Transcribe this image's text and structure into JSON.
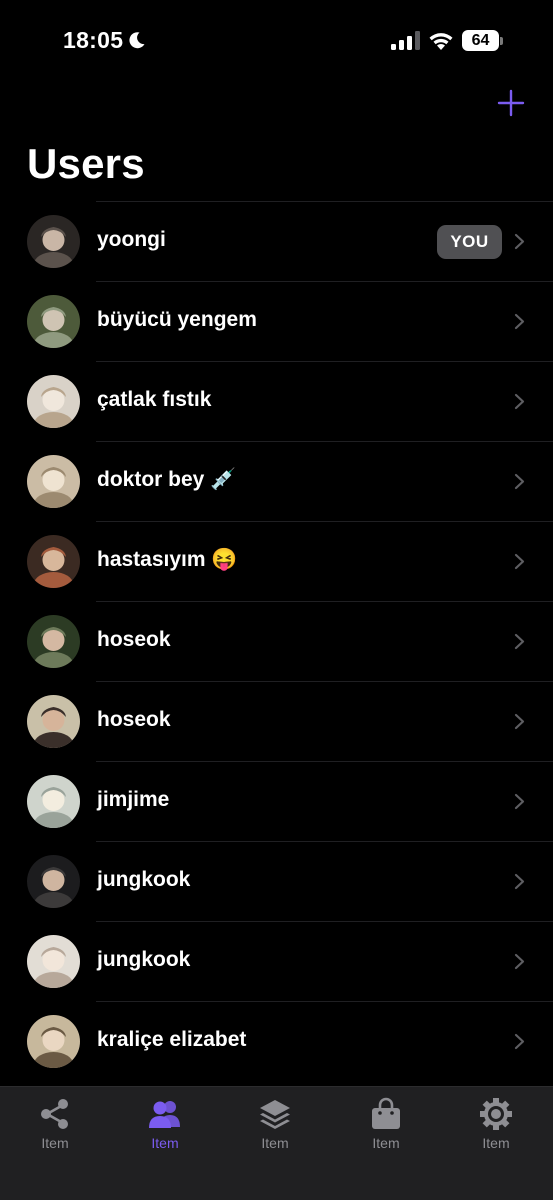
{
  "status_bar": {
    "time": "18:05",
    "battery": "64",
    "icons": [
      "moon-icon",
      "cellular-signal-icon",
      "wifi-icon",
      "battery-icon"
    ]
  },
  "header": {
    "title": "Users",
    "add_icon": "plus-icon"
  },
  "colors": {
    "accent": "#7b5cf0",
    "background": "#000000",
    "tab_bar": "#202022",
    "inactive_tab": "#8e8e93",
    "badge_bg": "#505053"
  },
  "users": [
    {
      "name": "yoongi",
      "badge": "YOU"
    },
    {
      "name": "büyücü yengem"
    },
    {
      "name": "çatlak fıstık"
    },
    {
      "name": "doktor bey 💉"
    },
    {
      "name": "hastasıyım 😝"
    },
    {
      "name": "hoseok"
    },
    {
      "name": "hoseok"
    },
    {
      "name": "jimjime"
    },
    {
      "name": "jungkook"
    },
    {
      "name": "jungkook"
    },
    {
      "name": "kraliçe elizabet"
    }
  ],
  "tab_bar": {
    "tabs": [
      {
        "label": "Item",
        "icon": "share-icon",
        "active": false
      },
      {
        "label": "Item",
        "icon": "users-icon",
        "active": true
      },
      {
        "label": "Item",
        "icon": "layers-icon",
        "active": false
      },
      {
        "label": "Item",
        "icon": "shopping-bag-icon",
        "active": false
      },
      {
        "label": "Item",
        "icon": "gear-icon",
        "active": false
      }
    ]
  }
}
